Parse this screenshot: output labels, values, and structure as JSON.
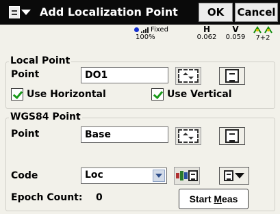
{
  "window": {
    "title": "Add Localization Point",
    "ok_label": "OK",
    "cancel_label": "Cancel"
  },
  "status": {
    "fix_type": "Fixed",
    "battery": "100%",
    "h_label": "H",
    "h_value": "0.062",
    "v_label": "V",
    "v_value": "0.059",
    "satellites": "7+2"
  },
  "local_point": {
    "group_title": "Local Point",
    "point_label": "Point",
    "point_value": "DO1",
    "use_horizontal_label": "Use Horizontal",
    "use_vertical_label": "Use Vertical",
    "use_horizontal_checked": true,
    "use_vertical_checked": true
  },
  "wgs84_point": {
    "group_title": "WGS84 Point",
    "point_label": "Point",
    "point_value": "Base",
    "code_label": "Code",
    "code_value": "Loc",
    "epoch_label": "Epoch Count:",
    "epoch_value": "0",
    "start_meas_prefix": "Start ",
    "start_meas_underlined": "M",
    "start_meas_suffix": "eas"
  },
  "icons": {
    "menu": "menu-dropdown-icon",
    "signal": "gps-signal-icon",
    "satellite": "satellite-icon",
    "coordinate_picker": "coordinate-picker-icon",
    "list": "list-icon",
    "code_settings": "code-settings-icon"
  },
  "colors": {
    "titlebar": "#0a0a0a",
    "background": "#f2f1ea",
    "checkmark": "#1a9a1a",
    "gps_dot": "#1530d0"
  }
}
